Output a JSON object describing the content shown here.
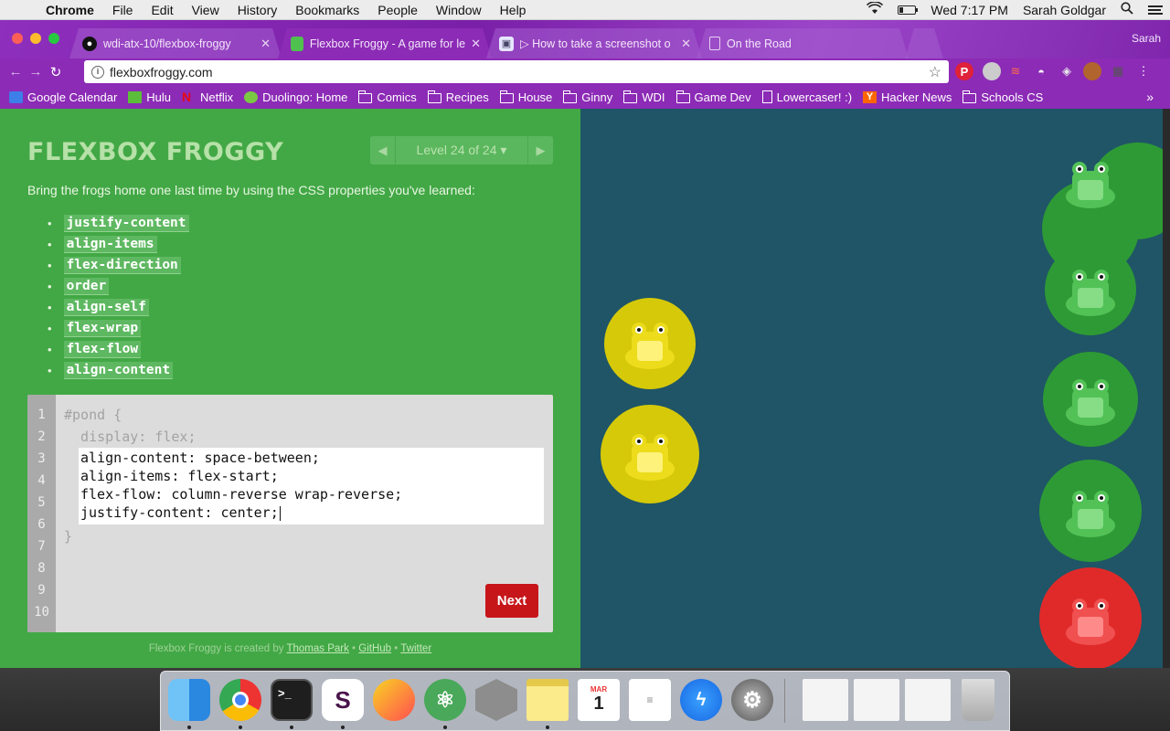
{
  "menubar": {
    "app": "Chrome",
    "items": [
      "File",
      "Edit",
      "View",
      "History",
      "Bookmarks",
      "People",
      "Window",
      "Help"
    ],
    "clock": "Wed 7:17 PM",
    "user": "Sarah Goldgar"
  },
  "tabs": [
    {
      "title": "wdi-atx-10/flexbox-froggy",
      "active": false
    },
    {
      "title": "Flexbox Froggy - A game for le",
      "active": true
    },
    {
      "title": "▷ How to take a screenshot o",
      "active": false
    },
    {
      "title": "On the Road",
      "active": false
    }
  ],
  "profile_name": "Sarah",
  "address": {
    "url": "flexboxfroggy.com"
  },
  "bookmarks": [
    {
      "label": "Google Calendar",
      "icon": "calendar-icon"
    },
    {
      "label": "Hulu",
      "icon": "hulu-icon"
    },
    {
      "label": "Netflix",
      "icon": "netflix-icon"
    },
    {
      "label": "Duolingo: Home",
      "icon": "duolingo-icon"
    },
    {
      "label": "Comics",
      "icon": "folder-icon"
    },
    {
      "label": "Recipes",
      "icon": "folder-icon"
    },
    {
      "label": "House",
      "icon": "folder-icon"
    },
    {
      "label": "Ginny",
      "icon": "folder-icon"
    },
    {
      "label": "WDI",
      "icon": "folder-icon"
    },
    {
      "label": "Game Dev",
      "icon": "folder-icon"
    },
    {
      "label": "Lowercaser! :)",
      "icon": "page-icon"
    },
    {
      "label": "Hacker News",
      "icon": "hacker-news-icon"
    },
    {
      "label": "Schools CS",
      "icon": "folder-icon"
    }
  ],
  "bookmarks_more": "»",
  "game": {
    "logo": "FLEXBOX FROGGY",
    "level": "Level 24 of 24",
    "instructions": "Bring the frogs home one last time by using the CSS properties you've learned:",
    "properties": [
      "justify-content",
      "align-items",
      "flex-direction",
      "order",
      "align-self",
      "flex-wrap",
      "flex-flow",
      "align-content"
    ],
    "line_numbers": [
      "1",
      "2",
      "3",
      "4",
      "5",
      "6",
      "7",
      "8",
      "9",
      "10"
    ],
    "code_before": [
      "#pond {",
      "  display: flex;"
    ],
    "code_input": [
      "align-content: space-between;",
      "align-items: flex-start;",
      "flex-flow: column-reverse wrap-reverse;",
      "justify-content: center;"
    ],
    "code_after": "}",
    "next_label": "Next",
    "credits_prefix": "Flexbox Froggy is created by",
    "credits_author": "Thomas Park",
    "credits_sep1": " • ",
    "credits_github": "GitHub",
    "credits_sep2": " • ",
    "credits_twitter": "Twitter"
  },
  "colors": {
    "pond": "#1f5566",
    "panel": "#42a845",
    "green_frog": "#2e9a35",
    "yellow_frog": "#d6c90a",
    "red_frog": "#e02a2a",
    "next_button": "#c6161a"
  },
  "frogs": [
    {
      "color": "yellow",
      "on_pad": "green"
    },
    {
      "color": "yellow",
      "on_pad": "green"
    }
  ],
  "lilypads": [
    "green",
    "green",
    "green",
    "green",
    "red"
  ],
  "dock": [
    "Finder",
    "Chrome",
    "Terminal",
    "Slack",
    "Brave",
    "Atom",
    "Pasta",
    "Notes",
    "Calendar",
    "Reminders",
    "Messenger",
    "System Preferences"
  ],
  "dock_calendar": {
    "month": "MAR",
    "day": "1"
  }
}
